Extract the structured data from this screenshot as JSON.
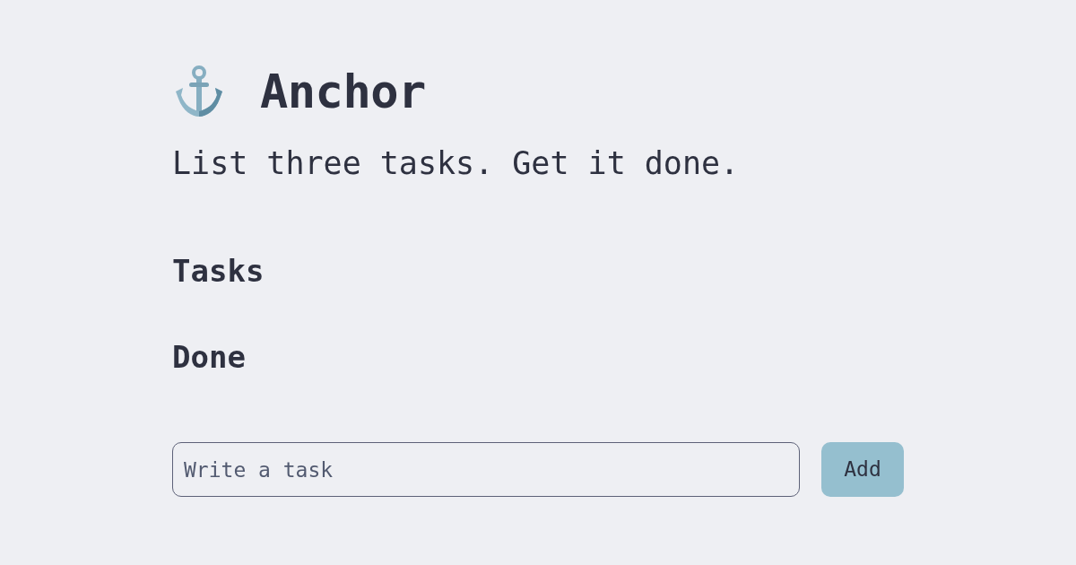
{
  "header": {
    "title": "Anchor",
    "tagline": "List three tasks. Get it done."
  },
  "sections": [
    {
      "heading": "Tasks"
    },
    {
      "heading": "Done"
    }
  ],
  "task_form": {
    "placeholder": "Write a task",
    "button": "Add"
  }
}
